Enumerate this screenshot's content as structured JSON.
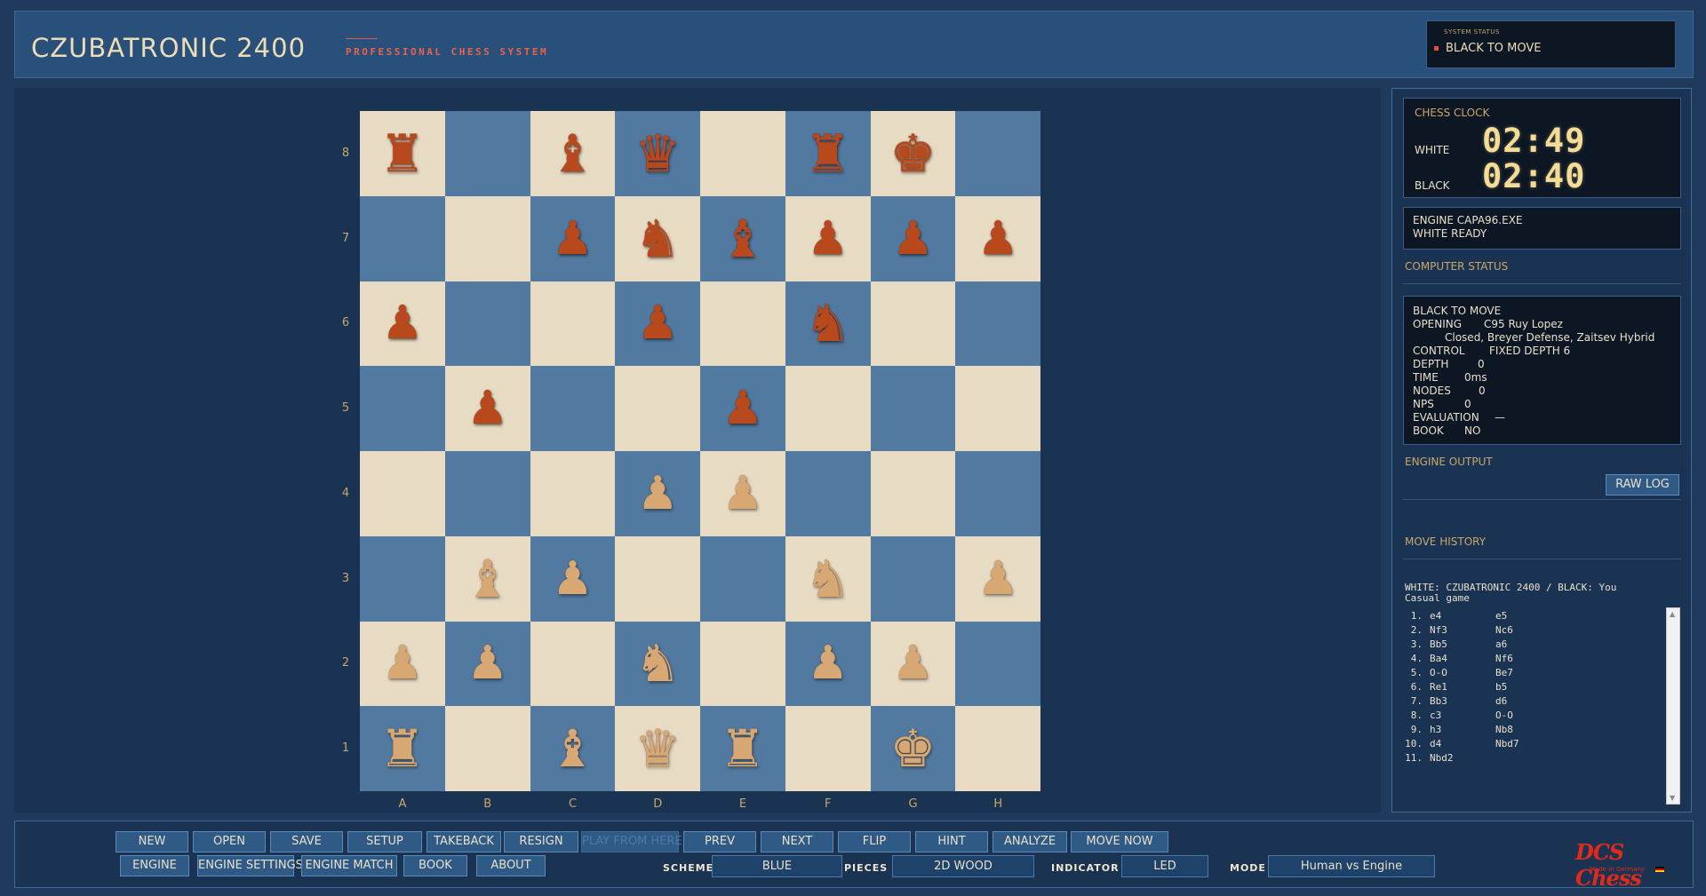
{
  "header": {
    "title": "CZUBATRONIC 2400",
    "tagline": "PROFESSIONAL CHESS SYSTEM",
    "system_status_label": "SYSTEM STATUS",
    "system_status_value": "BLACK TO MOVE"
  },
  "board": {
    "ranks": [
      "8",
      "7",
      "6",
      "5",
      "4",
      "3",
      "2",
      "1"
    ],
    "files": [
      "A",
      "B",
      "C",
      "D",
      "E",
      "F",
      "G",
      "H"
    ],
    "colors": {
      "light": "#e8dbc4",
      "dark": "#52799f",
      "black_piece": "#b8491c",
      "white_piece": "#d7a774"
    },
    "position": [
      [
        "bR",
        "",
        "bB",
        "bQ",
        "",
        "bR",
        "bK",
        ""
      ],
      [
        "",
        "",
        "bP",
        "bN",
        "bB",
        "bP",
        "bP",
        "bP"
      ],
      [
        "bP",
        "",
        "",
        "bP",
        "",
        "bN",
        "",
        ""
      ],
      [
        "",
        "bP",
        "",
        "",
        "bP",
        "",
        "",
        ""
      ],
      [
        "",
        "",
        "",
        "wP",
        "wP",
        "",
        "",
        ""
      ],
      [
        "",
        "wB",
        "wP",
        "",
        "",
        "wN",
        "",
        "wP"
      ],
      [
        "wP",
        "wP",
        "",
        "wN",
        "",
        "wP",
        "wP",
        ""
      ],
      [
        "wR",
        "",
        "wB",
        "wQ",
        "wR",
        "",
        "wK",
        ""
      ]
    ]
  },
  "clock": {
    "title": "CHESS CLOCK",
    "white_label": "WHITE",
    "white_time": "02:49",
    "black_label": "BLACK",
    "black_time": "02:40"
  },
  "engine": {
    "line1": "ENGINE  CAPA96.EXE",
    "line2": "WHITE READY"
  },
  "computer_status": {
    "section_label": "COMPUTER STATUS",
    "to_move": "BLACK TO MOVE",
    "opening_label": "OPENING",
    "opening_value": "C95 Ruy Lopez",
    "opening_detail": "Closed, Breyer Defense, Zaitsev Hybrid",
    "control_label": "CONTROL",
    "control_value": "FIXED DEPTH 6",
    "depth_label": "DEPTH",
    "depth_value": "0",
    "time_label": "TIME",
    "time_value": "0ms",
    "nodes_label": "NODES",
    "nodes_value": "0",
    "nps_label": "NPS",
    "nps_value": "0",
    "evaluation_label": "EVALUATION",
    "evaluation_value": "—",
    "book_label": "BOOK",
    "book_value": "NO"
  },
  "engine_output": {
    "section_label": "ENGINE OUTPUT",
    "raw_log_label": "RAW LOG"
  },
  "move_history": {
    "section_label": "MOVE HISTORY",
    "players_line": "WHITE: CZUBATRONIC 2400  /  BLACK: You",
    "game_type": "Casual game",
    "moves": [
      {
        "n": "1.",
        "w": "e4",
        "b": "e5"
      },
      {
        "n": "2.",
        "w": "Nf3",
        "b": "Nc6"
      },
      {
        "n": "3.",
        "w": "Bb5",
        "b": "a6"
      },
      {
        "n": "4.",
        "w": "Ba4",
        "b": "Nf6"
      },
      {
        "n": "5.",
        "w": "O-O",
        "b": "Be7"
      },
      {
        "n": "6.",
        "w": "Re1",
        "b": "b5"
      },
      {
        "n": "7.",
        "w": "Bb3",
        "b": "d6"
      },
      {
        "n": "8.",
        "w": "c3",
        "b": "O-O"
      },
      {
        "n": "9.",
        "w": "h3",
        "b": "Nb8"
      },
      {
        "n": "10.",
        "w": "d4",
        "b": "Nbd7"
      },
      {
        "n": "11.",
        "w": "Nbd2",
        "b": ""
      }
    ]
  },
  "toolbar": {
    "row1": [
      "NEW",
      "OPEN",
      "SAVE",
      "SETUP",
      "TAKEBACK",
      "RESIGN",
      "PLAY FROM HERE",
      "PREV",
      "NEXT",
      "FLIP",
      "HINT",
      "ANALYZE",
      "MOVE NOW"
    ],
    "row2": [
      "ENGINE",
      "ENGINE SETTINGS",
      "ENGINE MATCH",
      "BOOK",
      "ABOUT"
    ],
    "scheme_label": "SCHEME",
    "scheme_value": "BLUE",
    "pieces_label": "PIECES",
    "pieces_value": "2D WOOD",
    "indicator_label": "INDICATOR",
    "indicator_value": "LED",
    "mode_label": "MODE",
    "mode_value": "Human vs Engine"
  },
  "brand": {
    "logo": "DCS Chess",
    "sub": "Made in Germany"
  }
}
